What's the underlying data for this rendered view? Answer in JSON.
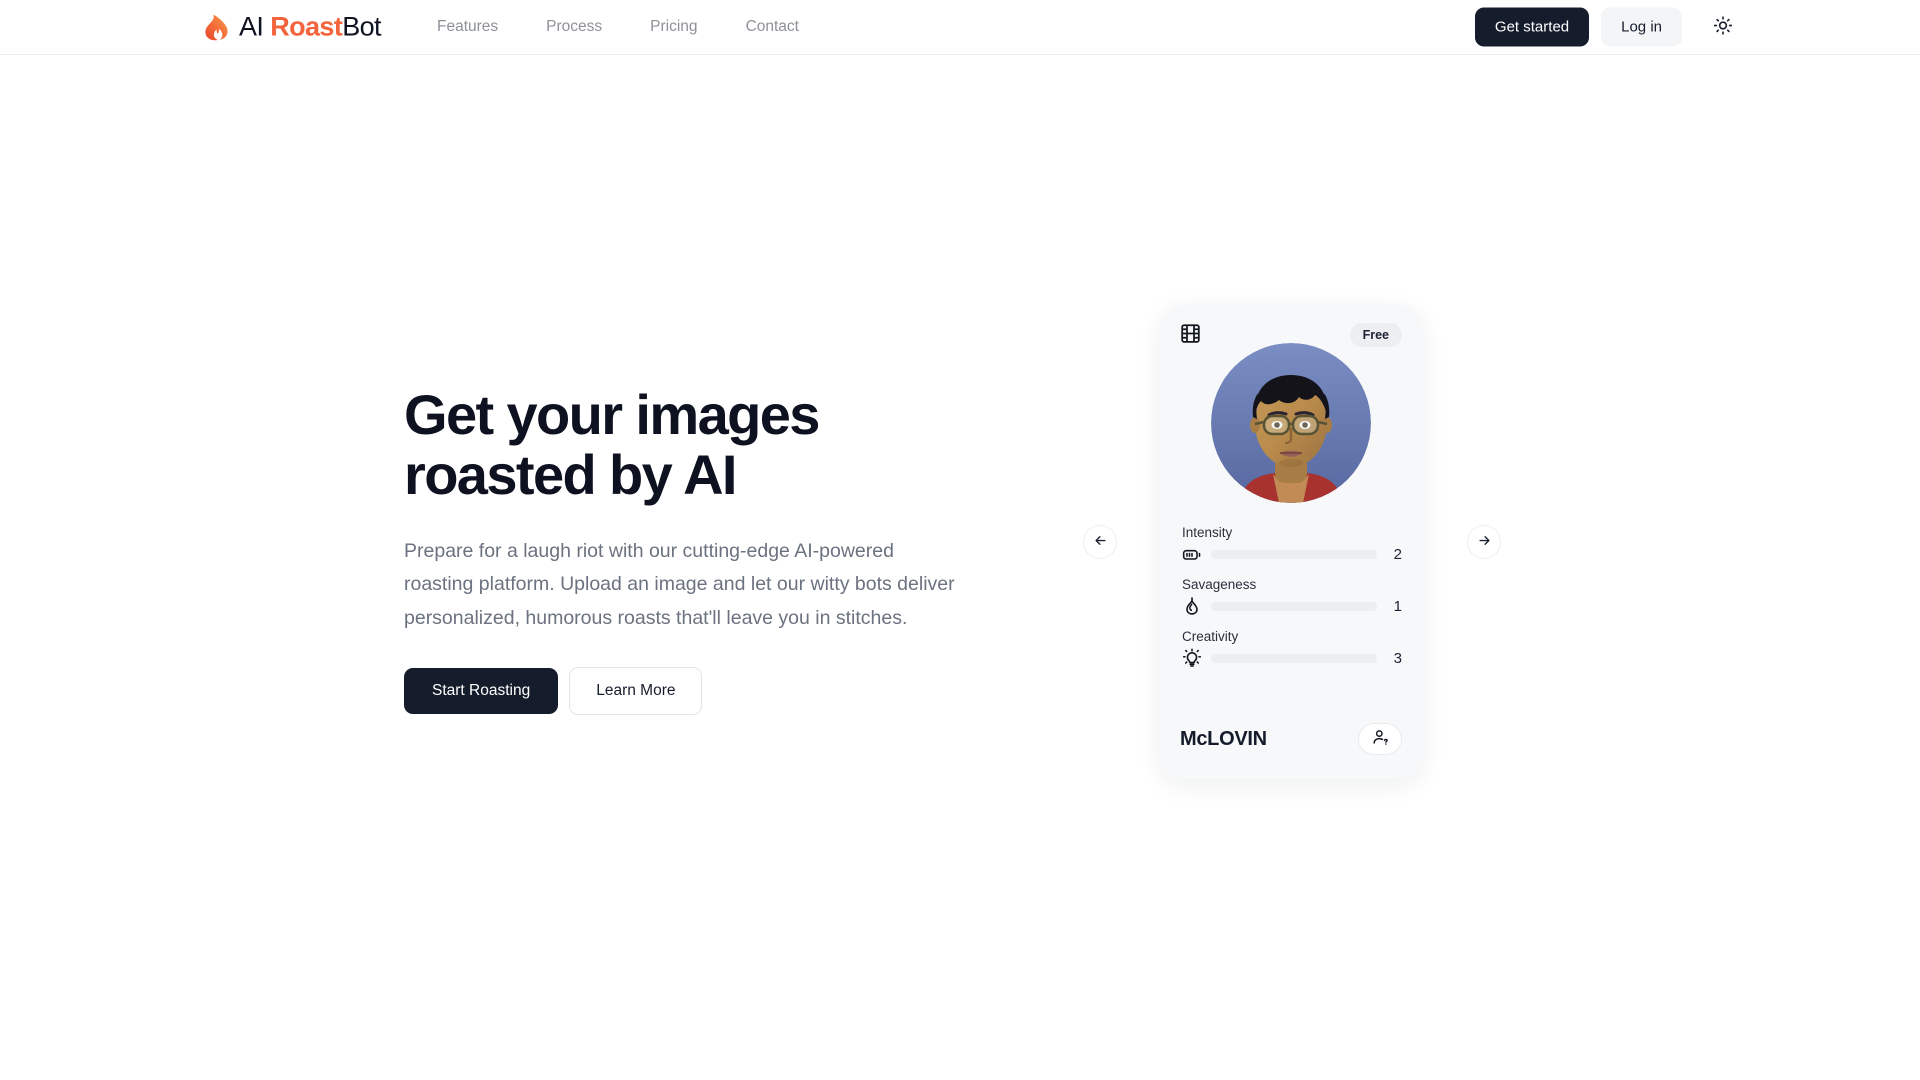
{
  "header": {
    "logo_icon": "flame-icon",
    "brand_prefix": "AI ",
    "brand_accent": "Roast",
    "brand_suffix": "Bot",
    "nav": [
      {
        "label": "Features"
      },
      {
        "label": "Process"
      },
      {
        "label": "Pricing"
      },
      {
        "label": "Contact"
      }
    ],
    "get_started_label": "Get started",
    "login_label": "Log in",
    "theme_toggle_icon": "sun-icon"
  },
  "hero": {
    "title": "Get your images\nroasted by AI",
    "subtitle": "Prepare for a laugh riot with our cutting-edge AI-powered roasting platform. Upload an image and let our witty bots deliver personalized, humorous roasts that'll leave you in stitches.",
    "primary_label": "Start Roasting",
    "secondary_label": "Learn More"
  },
  "carousel": {
    "prev_icon": "arrow-left-icon",
    "next_icon": "arrow-right-icon",
    "card": {
      "media_icon": "film-strip-icon",
      "badge": "Free",
      "avatar_alt": "portrait-photo",
      "name": "McLOVIN",
      "identify_icon": "person-question-icon",
      "stats": [
        {
          "label": "Intensity",
          "icon": "battery-icon",
          "value": 2,
          "max": 9,
          "percent": 22
        },
        {
          "label": "Savageness",
          "icon": "flame-icon",
          "value": 1,
          "max": 9,
          "percent": 9
        },
        {
          "label": "Creativity",
          "icon": "lightbulb-icon",
          "value": 3,
          "max": 9,
          "percent": 33
        }
      ]
    }
  },
  "colors": {
    "accent": "#f4643c",
    "dark": "#151c2c",
    "bar_green": "#3ce923",
    "card_bg": "#f7f8fa",
    "muted_text": "#6b7280"
  }
}
